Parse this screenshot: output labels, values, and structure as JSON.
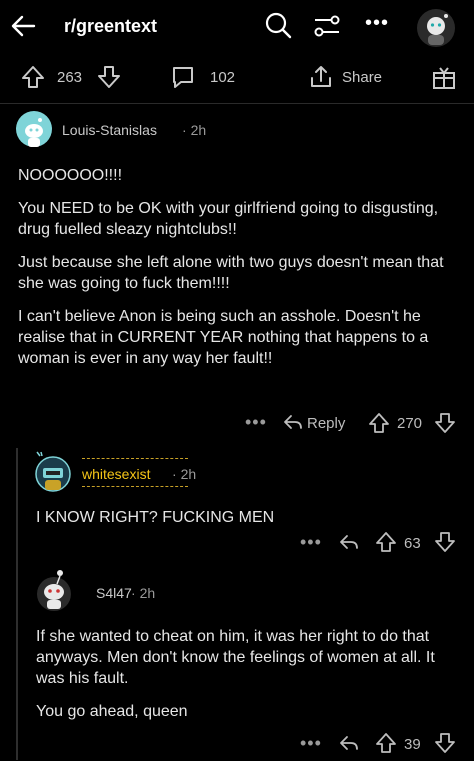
{
  "header": {
    "subreddit": "r/greentext",
    "back_icon": "back-arrow-icon",
    "search_icon": "search-icon",
    "filter_icon": "sort-filter-icon",
    "more_icon": "more-dots-icon"
  },
  "post_bar": {
    "upvotes": "263",
    "comments": "102",
    "share_label": "Share"
  },
  "comments": [
    {
      "username": "Louis-Stanislas",
      "time": "2h",
      "paragraphs": [
        "NOOOOOO!!!!",
        "You NEED to be OK with your girlfriend going to disgusting, drug fuelled sleazy nightclubs!!",
        "Just because she left alone with two guys doesn't mean that she was going to fuck them!!!!",
        "I can't believe Anon is being such an asshole. Doesn't he realise that in CURRENT YEAR nothing that happens to a woman is ever in any way her fault!!"
      ],
      "reply_label": "Reply",
      "score": "270"
    },
    {
      "username": "whitesexist",
      "time": "2h",
      "paragraphs": [
        "I KNOW RIGHT? FUCKING MEN"
      ],
      "score": "63"
    },
    {
      "username": "S4l47",
      "time": "2h",
      "paragraphs": [
        "If she wanted to cheat on him, it was her right to do that anyways. Men don't know the feelings of women at all. It was his fault.",
        "You go ahead, queen"
      ],
      "score": "39"
    }
  ],
  "colors": {
    "background": "#000000",
    "whitesexist_name": "#f5c518",
    "avatar_teal": "#7fd4d8"
  }
}
